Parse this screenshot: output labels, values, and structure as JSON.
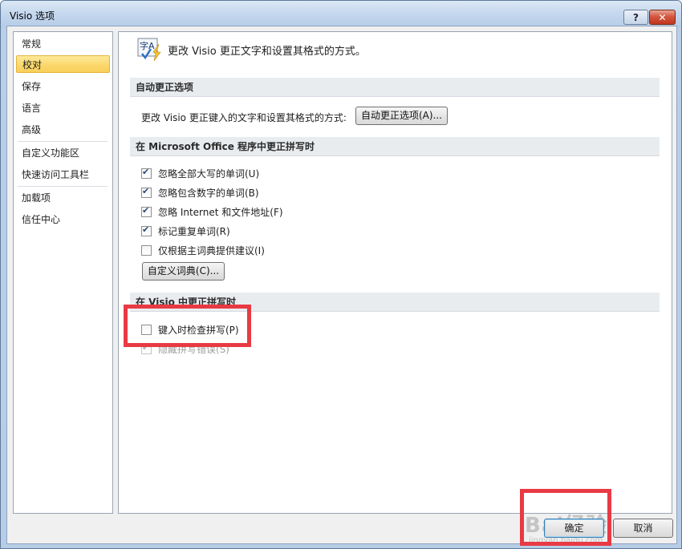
{
  "window": {
    "title": "Visio 选项",
    "help_label": "?",
    "close_label": "✕"
  },
  "nav": {
    "items": [
      "常规",
      "校对",
      "保存",
      "语言",
      "高级",
      "自定义功能区",
      "快速访问工具栏",
      "加载项",
      "信任中心"
    ],
    "selected": "校对"
  },
  "header": {
    "icon_text": "字A",
    "text": "更改 Visio 更正文字和设置其格式的方式。"
  },
  "autocorrect": {
    "heading": "自动更正选项",
    "label": "更改 Visio 更正键入的文字和设置其格式的方式:",
    "button": "自动更正选项(A)..."
  },
  "office_spelling": {
    "heading": "在 Microsoft Office 程序中更正拼写时",
    "options": [
      {
        "label": "忽略全部大写的单词(U)",
        "checked": true
      },
      {
        "label": "忽略包含数字的单词(B)",
        "checked": true
      },
      {
        "label": "忽略 Internet 和文件地址(F)",
        "checked": true
      },
      {
        "label": "标记重复单词(R)",
        "checked": true
      },
      {
        "label": "仅根据主词典提供建议(I)",
        "checked": false
      }
    ],
    "dict_button": "自定义词典(C)..."
  },
  "visio_spelling": {
    "heading": "在 Visio 中更正拼写时",
    "options": [
      {
        "label": "键入时检查拼写(P)",
        "checked": false,
        "disabled": false
      },
      {
        "label": "隐藏拼写错误(S)",
        "checked": true,
        "disabled": true
      }
    ]
  },
  "footer": {
    "ok": "确定",
    "cancel": "取消"
  },
  "watermark": {
    "text": "Bai经验",
    "sub": "jingyan.baidu.com"
  },
  "colors": {
    "highlight": "#e83a44",
    "selected_nav": "#fbd76a"
  }
}
